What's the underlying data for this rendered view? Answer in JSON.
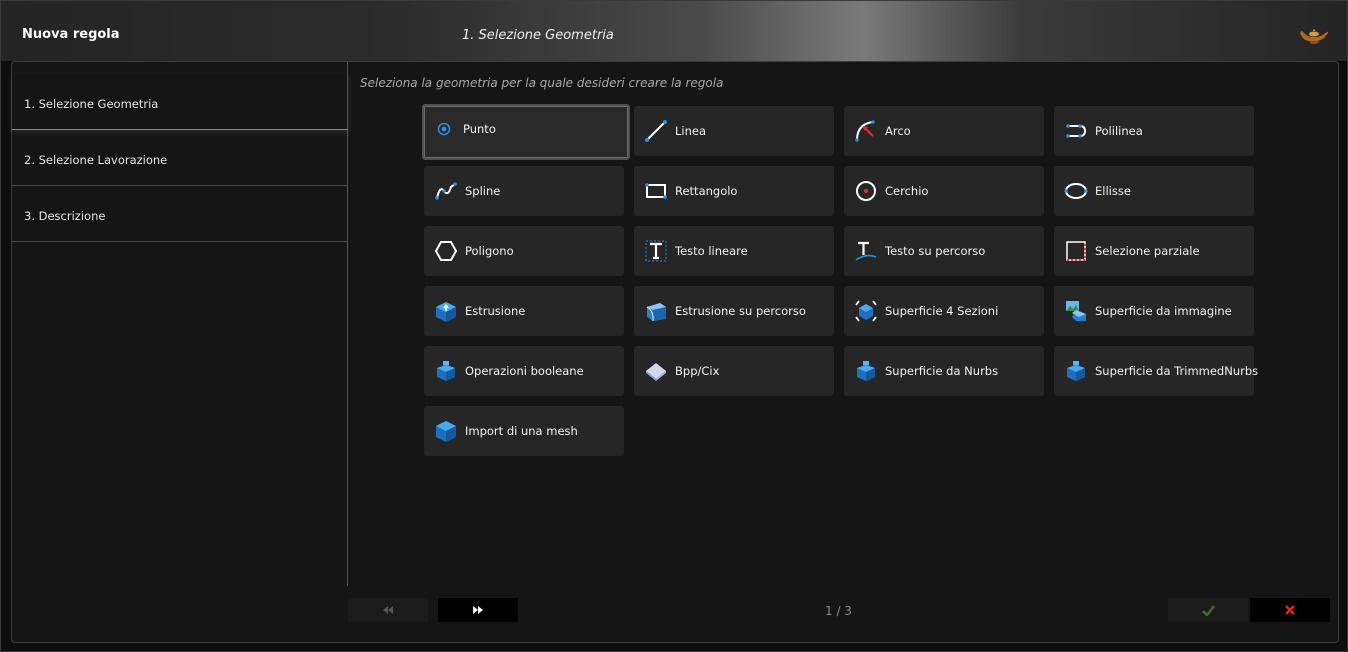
{
  "window": {
    "title": "Nuova regola",
    "step_title": "1. Selezione Geometria"
  },
  "sidebar": {
    "steps": [
      {
        "label": "1. Selezione Geometria"
      },
      {
        "label": "2. Selezione Lavorazione"
      },
      {
        "label": "3. Descrizione"
      }
    ]
  },
  "main": {
    "hint": "Seleziona la geometria per la quale desideri creare la regola",
    "tiles": [
      {
        "label": "Punto",
        "icon": "point-icon"
      },
      {
        "label": "Linea",
        "icon": "line-icon"
      },
      {
        "label": "Arco",
        "icon": "arc-icon"
      },
      {
        "label": "Polilinea",
        "icon": "polyline-icon"
      },
      {
        "label": "Spline",
        "icon": "spline-icon"
      },
      {
        "label": "Rettangolo",
        "icon": "rectangle-icon"
      },
      {
        "label": "Cerchio",
        "icon": "circle-icon"
      },
      {
        "label": "Ellisse",
        "icon": "ellipse-icon"
      },
      {
        "label": "Poligono",
        "icon": "polygon-icon"
      },
      {
        "label": "Testo lineare",
        "icon": "linear-text-icon"
      },
      {
        "label": "Testo su percorso",
        "icon": "path-text-icon"
      },
      {
        "label": "Selezione parziale",
        "icon": "partial-selection-icon"
      },
      {
        "label": "Estrusione",
        "icon": "extrusion-icon"
      },
      {
        "label": "Estrusione su percorso",
        "icon": "path-extrusion-icon"
      },
      {
        "label": "Superficie 4 Sezioni",
        "icon": "four-section-surface-icon"
      },
      {
        "label": "Superficie da immagine",
        "icon": "image-surface-icon"
      },
      {
        "label": "Operazioni booleane",
        "icon": "boolean-operations-icon"
      },
      {
        "label": "Bpp/Cix",
        "icon": "bpp-cix-icon"
      },
      {
        "label": "Superficie da Nurbs",
        "icon": "nurbs-surface-icon"
      },
      {
        "label": "Superficie da TrimmedNurbs",
        "icon": "trimmed-nurbs-surface-icon"
      },
      {
        "label": "Import di una mesh",
        "icon": "mesh-import-icon"
      }
    ],
    "selected": "Punto"
  },
  "footer": {
    "prev_icon": "rewind-icon",
    "next_icon": "fast-forward-icon",
    "page": "1 / 3",
    "ok_icon": "checkmark-icon",
    "cancel_icon": "x-icon"
  },
  "colors": {
    "accent_blue": "#2a8fe0",
    "accent_red": "#e03030",
    "ok_green": "#3e6b2e",
    "cancel_red": "#e0241f"
  }
}
